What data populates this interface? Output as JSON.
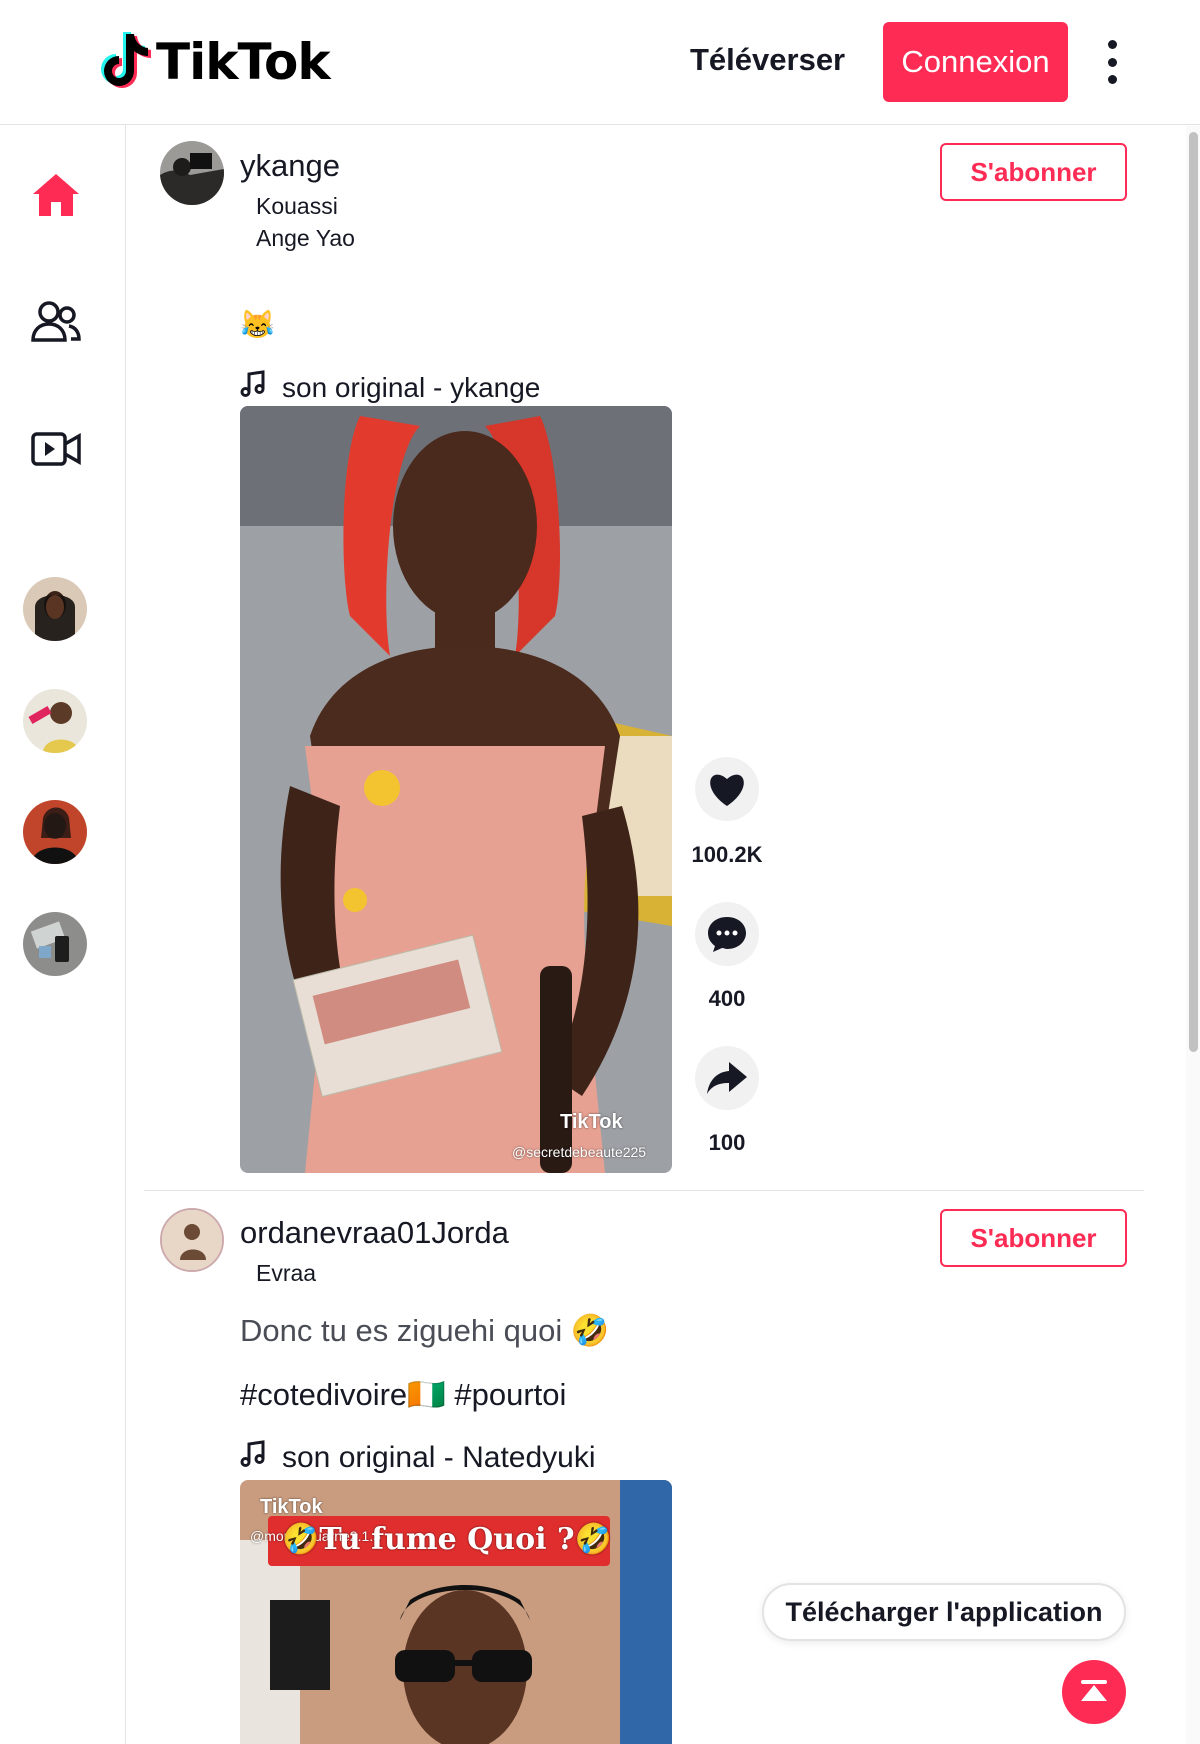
{
  "header": {
    "logo_text": "TikTok",
    "upload_label": "Téléverser",
    "login_label": "Connexion",
    "more_icon": "more-vertical-icon"
  },
  "sidebar": {
    "nav": [
      {
        "icon": "home-icon",
        "active": true
      },
      {
        "icon": "following-icon",
        "active": false
      },
      {
        "icon": "live-icon",
        "active": false
      }
    ],
    "accounts": [
      "account-1",
      "account-2",
      "account-3",
      "account-4"
    ]
  },
  "posts": [
    {
      "username": "ykange",
      "nickname": "Kouassi Ange Yao",
      "caption": "😹",
      "music": "son original - ykange",
      "follow_label": "S'abonner",
      "likes": "100.2K",
      "comments": "400",
      "shares": "100",
      "watermark_brand": "TikTok",
      "watermark_handle": "@secretdebeaute225"
    },
    {
      "username": "ordanevraa01Jorda",
      "nickname": "Evraa",
      "caption": "Donc tu es ziguehi quoi 🤣",
      "hashtags": "#cotedivoire🇨🇮 #pourtoi",
      "music": "son original - Natedyuki",
      "follow_label": "S'abonner",
      "watermark_brand": "TikTok",
      "watermark_handle": "@moreikouarne2.1.5",
      "overlay_text": "🤣Tu fume Quoi ?🤣"
    }
  ],
  "floating": {
    "download_label": "Télécharger l'application",
    "top_icon": "back-to-top-icon"
  },
  "colors": {
    "accent": "#fe2c55",
    "text": "#161823",
    "border": "#e3e3e4"
  }
}
